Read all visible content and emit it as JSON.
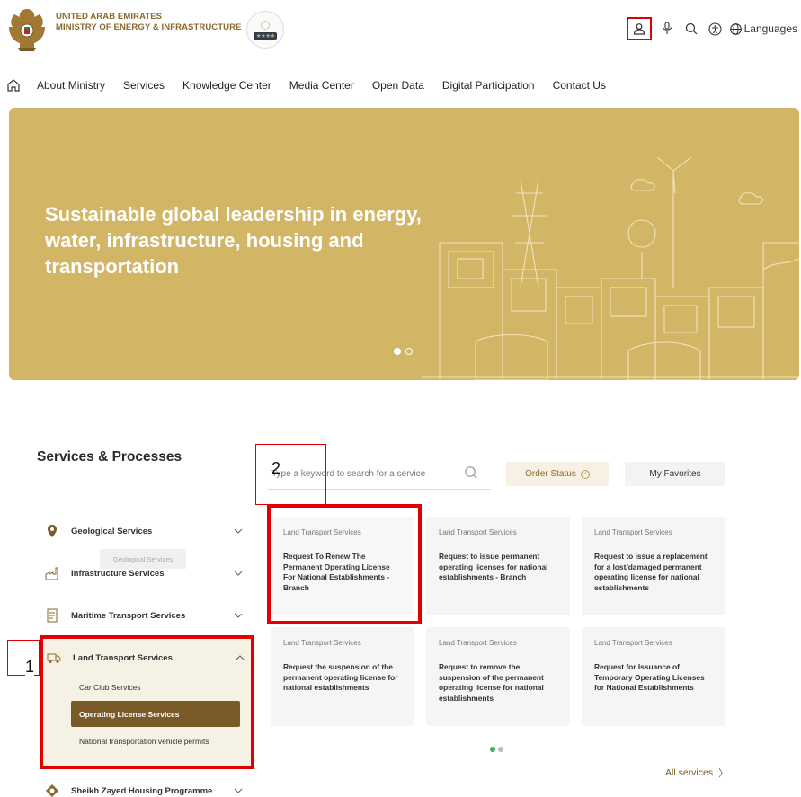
{
  "header": {
    "org_line1": "UNITED ARAB EMIRATES",
    "org_line2": "MINISTRY OF ENERGY & INFRASTRUCTURE",
    "languages_label": "Languages",
    "stars": "★★★★"
  },
  "nav": {
    "items": [
      "About Ministry",
      "Services",
      "Knowledge Center",
      "Media Center",
      "Open Data",
      "Digital Participation",
      "Contact Us"
    ]
  },
  "hero": {
    "title": "Sustainable global leadership in energy, water, infrastructure, housing and transportation"
  },
  "services": {
    "title": "Services & Processes",
    "search_placeholder": "Type a keyword to search for a service",
    "order_status_label": "Order Status",
    "favorites_label": "My Favorites",
    "all_services_label": "All services",
    "tooltip": "Geological Services",
    "categories": [
      {
        "label": "Geological Services",
        "icon": "map-pin-icon"
      },
      {
        "label": "Infrastructure Services",
        "icon": "factory-icon"
      },
      {
        "label": "Maritime Transport Services",
        "icon": "document-icon"
      },
      {
        "label": "Land Transport Services",
        "icon": "truck-icon"
      },
      {
        "label": "Sheikh Zayed Housing Programme",
        "icon": "housing-emblem-icon"
      }
    ],
    "land_subitems": [
      "Car Club Services",
      "Operating License Services",
      "National transportation vehicle permits"
    ],
    "cards": [
      {
        "category": "Land Transport Services",
        "title": "Request To Renew The Permanent Operating License For National Establishments - Branch"
      },
      {
        "category": "Land Transport Services",
        "title": "Request to issue permanent operating licenses for national establishments - Branch"
      },
      {
        "category": "Land Transport Services",
        "title": "Request to issue a replacement for a lost/damaged permanent operating license for national establishments"
      },
      {
        "category": "Land Transport Services",
        "title": "Request the suspension of the permanent operating license for national establishments"
      },
      {
        "category": "Land Transport Services",
        "title": "Request to remove the suspension of the permanent operating license for national establishments"
      },
      {
        "category": "Land Transport Services",
        "title": "Request for Issuance of Temporary Operating Licenses for National Establishments"
      }
    ]
  },
  "annotations": {
    "label1": "1",
    "label2": "2"
  },
  "colors": {
    "brand_gold": "#d3b566",
    "brand_brown": "#7a5a28",
    "highlight_red": "#e00000"
  }
}
